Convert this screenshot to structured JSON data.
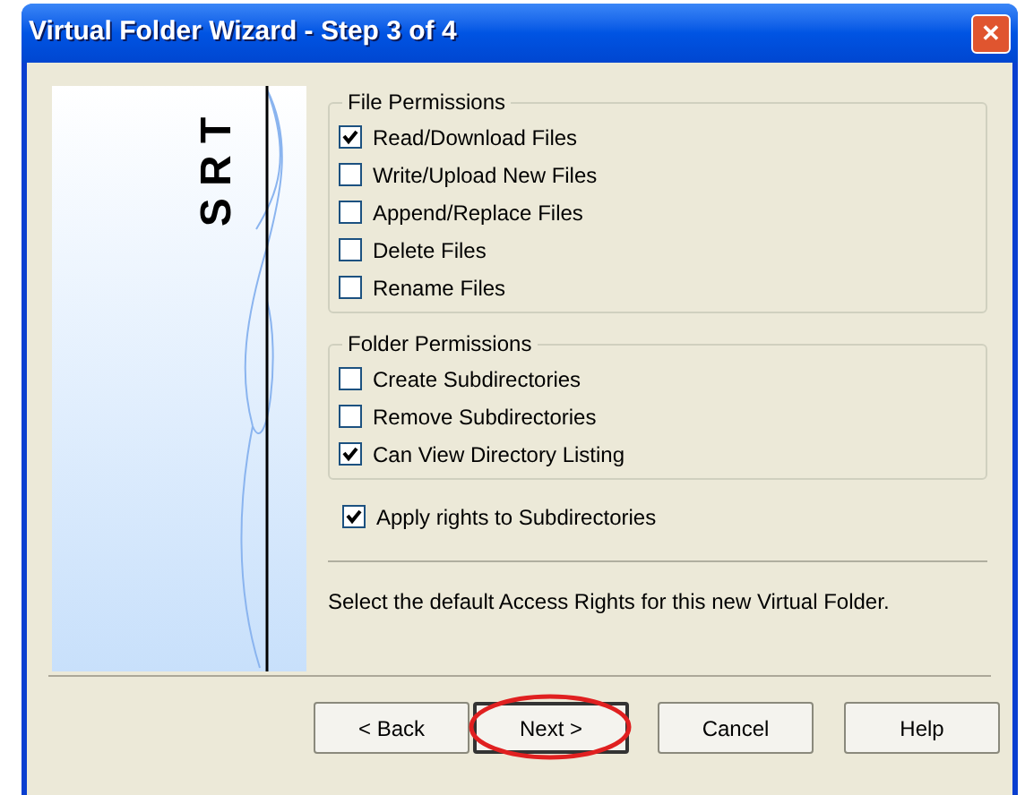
{
  "window": {
    "title": "Virtual Folder Wizard - Step 3 of 4",
    "close": "✕"
  },
  "logo": {
    "text": "S R T"
  },
  "groups": [
    {
      "title": "File Permissions",
      "items": [
        {
          "label": "Read/Download Files",
          "checked": true
        },
        {
          "label": "Write/Upload New Files",
          "checked": false
        },
        {
          "label": "Append/Replace Files",
          "checked": false
        },
        {
          "label": "Delete Files",
          "checked": false
        },
        {
          "label": "Rename Files",
          "checked": false
        }
      ]
    },
    {
      "title": "Folder Permissions",
      "items": [
        {
          "label": "Create Subdirectories",
          "checked": false
        },
        {
          "label": "Remove Subdirectories",
          "checked": false
        },
        {
          "label": "Can View Directory Listing",
          "checked": true
        }
      ]
    }
  ],
  "apply": {
    "label": "Apply rights to Subdirectories",
    "checked": true
  },
  "hint": "Select the default Access Rights for this new Virtual Folder.",
  "buttons": [
    {
      "label": "< Back",
      "selected": false
    },
    {
      "label": "Next >",
      "selected": true
    },
    {
      "label": "Cancel",
      "selected": false
    },
    {
      "label": "Help",
      "selected": false
    }
  ]
}
